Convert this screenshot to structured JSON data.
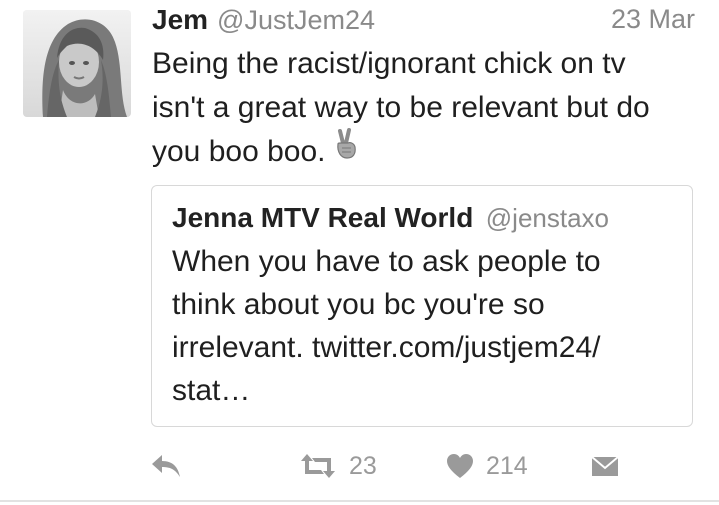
{
  "tweet": {
    "author_name": "Jem",
    "author_handle": "@JustJem24",
    "timestamp": "23 Mar",
    "text_lines": [
      "Being the racist/ignorant chick on tv",
      "isn't a great way to be relevant but do",
      "you boo boo."
    ],
    "emoji": "victory-hand-icon",
    "quoted": {
      "author_name": "Jenna MTV Real World",
      "author_handle": "@jenstaxo",
      "text_lines": [
        "When you have to ask people to",
        "think about you bc you're so",
        "irrelevant.  twitter.com/justjem24/",
        "stat…"
      ]
    },
    "actions": {
      "reply_icon": "reply-icon",
      "retweet_icon": "retweet-icon",
      "retweet_count": "23",
      "like_icon": "heart-icon",
      "like_count": "214",
      "message_icon": "envelope-icon"
    }
  },
  "colors": {
    "text": "#1f1f1f",
    "muted": "#8a8a8a",
    "icon": "#9a9a9a",
    "border": "#d8d8d8"
  }
}
